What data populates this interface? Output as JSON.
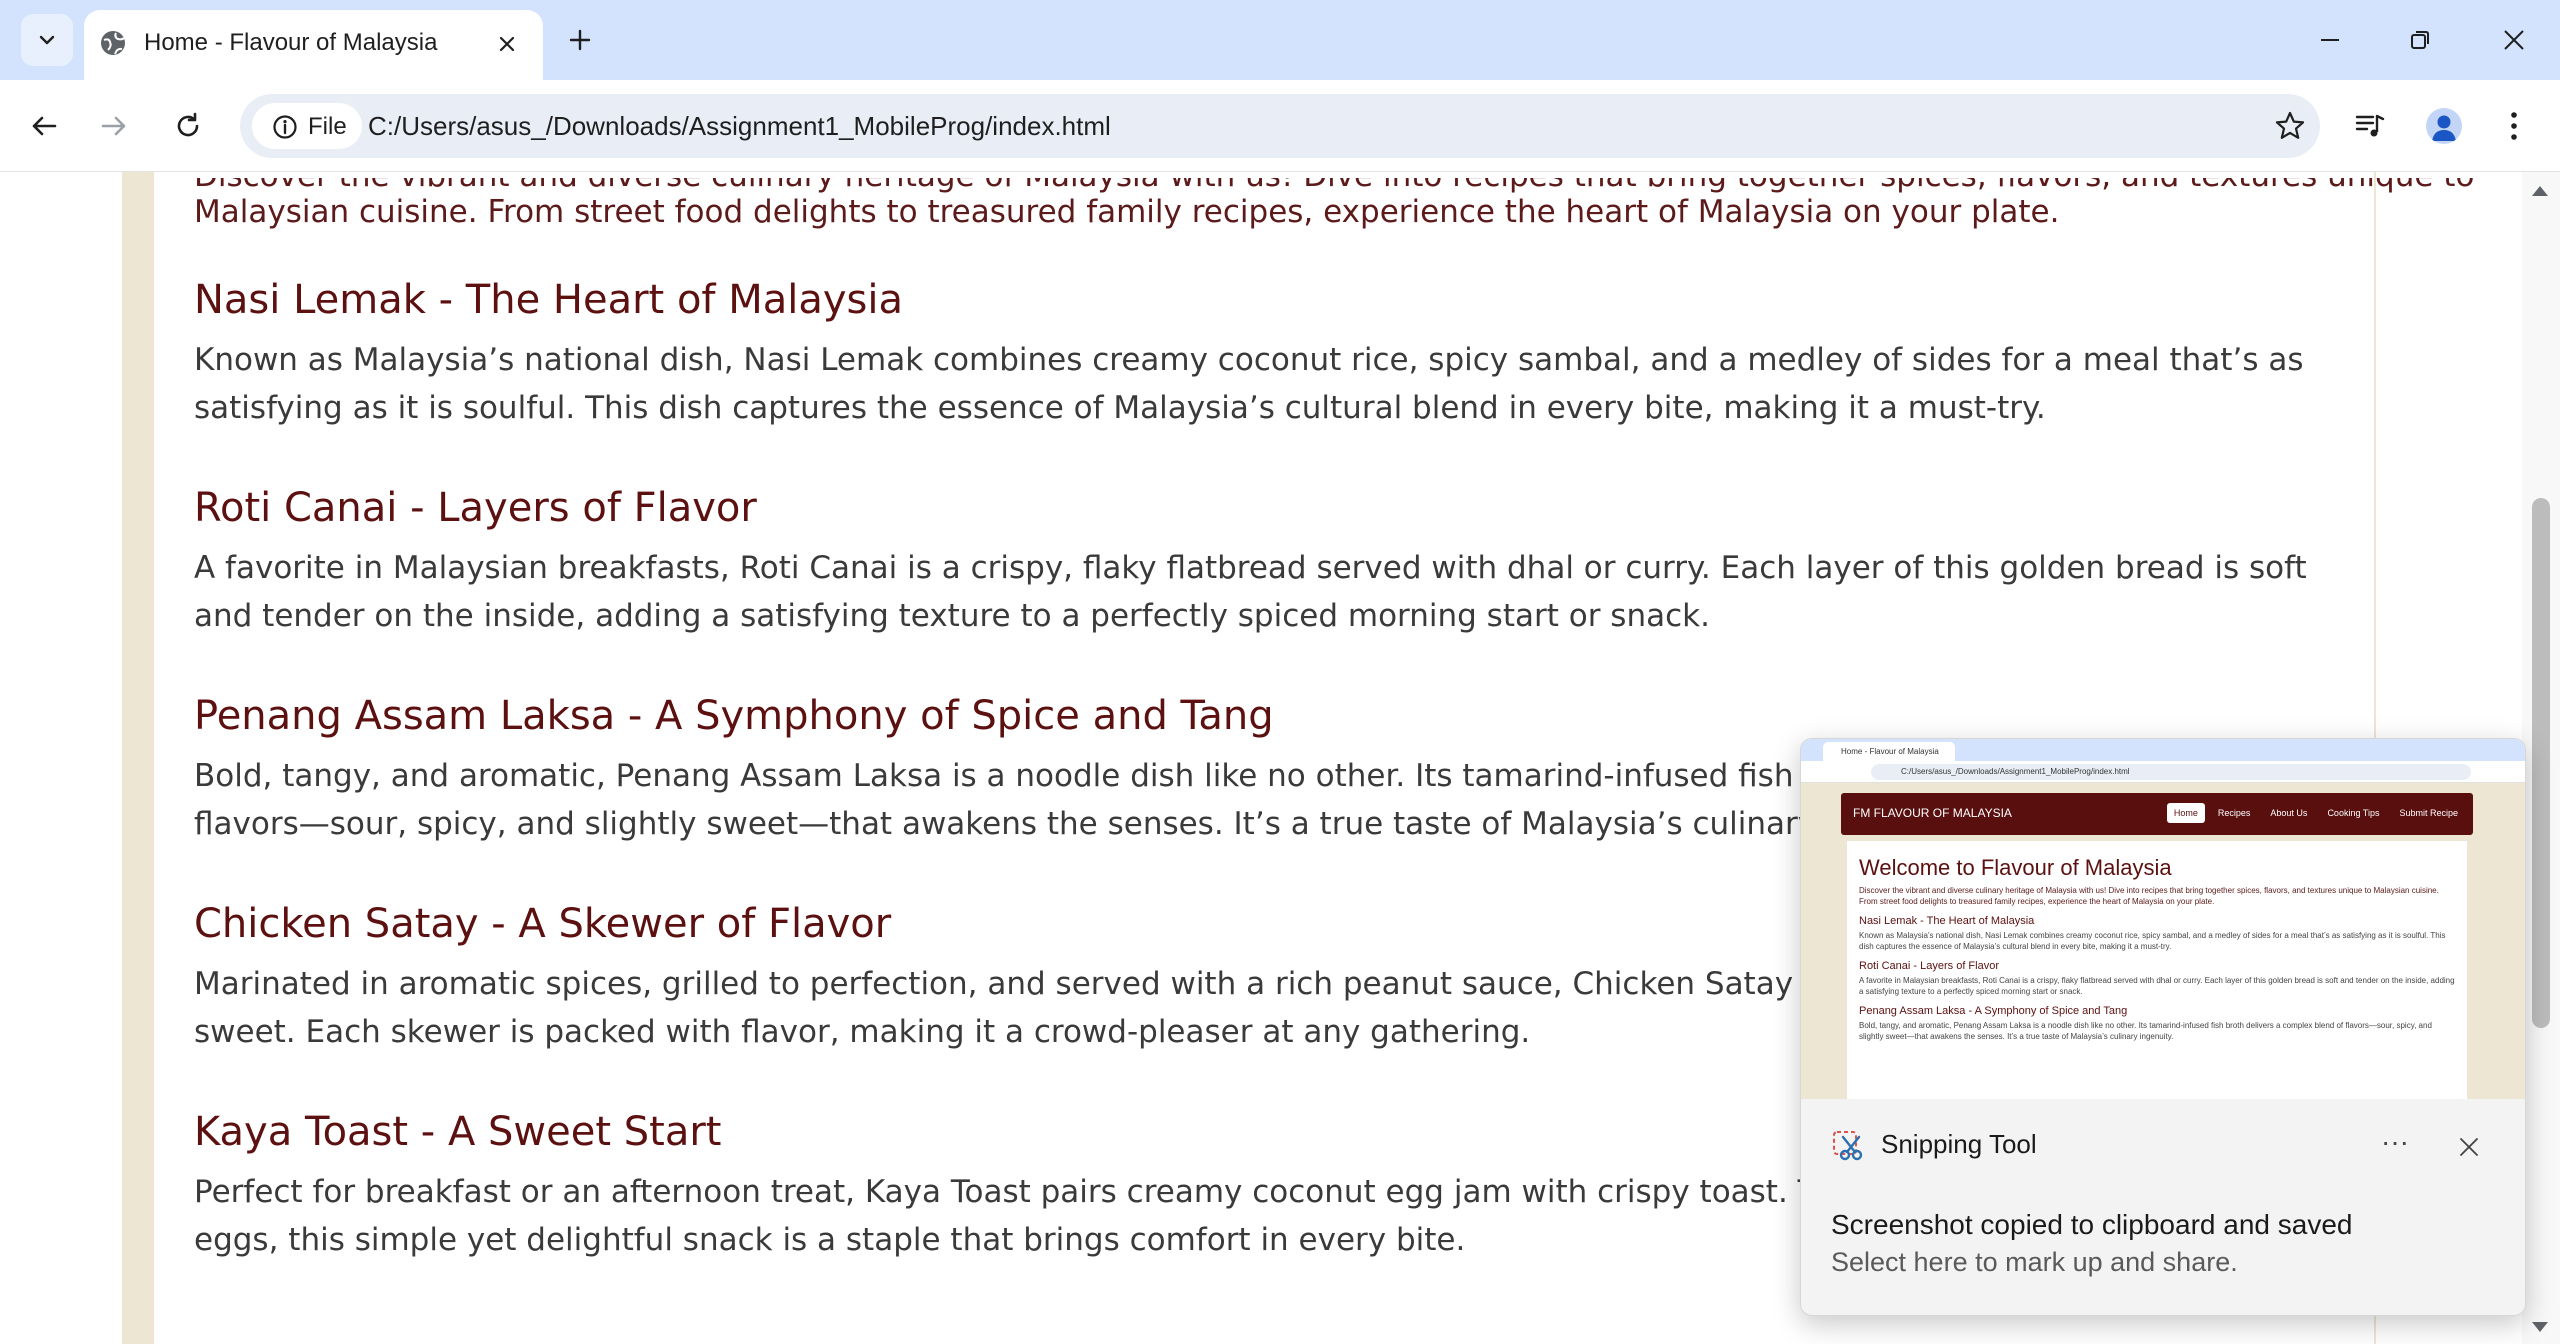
{
  "browser": {
    "tab_title": "Home - Flavour of Malaysia",
    "site_chip_label": "File",
    "url": "C:/Users/asus_/Downloads/Assignment1_MobileProg/index.html"
  },
  "page": {
    "intro_partial": "Discover the vibrant and diverse culinary heritage of Malaysia with us! Dive into recipes that bring together spices, flavors, and textures unique to",
    "intro_line2": "Malaysian cuisine. From street food delights to treasured family recipes, experience the heart of Malaysia on your plate.",
    "sections": [
      {
        "title": "Nasi Lemak - The Heart of Malaysia",
        "body": "Known as Malaysia’s national dish, Nasi Lemak combines creamy coconut rice, spicy sambal, and a medley of sides for a meal that’s as satisfying as it is soulful. This dish captures the essence of Malaysia’s cultural blend in every bite, making it a must-try."
      },
      {
        "title": "Roti Canai - Layers of Flavor",
        "body": "A favorite in Malaysian breakfasts, Roti Canai is a crispy, flaky flatbread served with dhal or curry. Each layer of this golden bread is soft and tender on the inside, adding a satisfying texture to a perfectly spiced morning start or snack."
      },
      {
        "title": "Penang Assam Laksa - A Symphony of Spice and Tang",
        "body": "Bold, tangy, and aromatic, Penang Assam Laksa is a noodle dish like no other. Its tamarind-infused fish broth delivers a complex blend of flavors—sour, spicy, and slightly sweet—that awakens the senses. It’s a true taste of Malaysia’s culinary ingenuity."
      },
      {
        "title": "Chicken Satay - A Skewer of Flavor",
        "body": "Marinated in aromatic spices, grilled to perfection, and served with a rich peanut sauce, Chicken Satay is the ideal blend of savory and sweet. Each skewer is packed with flavor, making it a crowd-pleaser at any gathering."
      },
      {
        "title": "Kaya Toast - A Sweet Start",
        "body": "Perfect for breakfast or an afternoon treat, Kaya Toast pairs creamy coconut egg jam with crispy toast. Traditionally served with soft-boiled eggs, this simple yet delightful snack is a staple that brings comfort in every bite."
      }
    ]
  },
  "notification": {
    "app_name": "Snipping Tool",
    "more_label": "···",
    "title": "Screenshot copied to clipboard and saved",
    "subtitle": "Select here to mark up and share.",
    "preview": {
      "tab_title": "Home - Flavour of Malaysia",
      "url": "C:/Users/asus_/Downloads/Assignment1_MobileProg/index.html",
      "brand": "FM  FLAVOUR OF MALAYSIA",
      "nav": [
        "Home",
        "Recipes",
        "About Us",
        "Cooking Tips",
        "Submit Recipe"
      ],
      "heading": "Welcome to Flavour of Malaysia",
      "intro": "Discover the vibrant and diverse culinary heritage of Malaysia with us! Dive into recipes that bring together spices, flavors, and textures unique to Malaysian cuisine. From street food delights to treasured family recipes, experience the heart of Malaysia on your plate.",
      "sections": [
        {
          "title": "Nasi Lemak - The Heart of Malaysia",
          "body": "Known as Malaysia’s national dish, Nasi Lemak combines creamy coconut rice, spicy sambal, and a medley of sides for a meal that’s as satisfying as it is soulful. This dish captures the essence of Malaysia’s cultural blend in every bite, making it a must-try."
        },
        {
          "title": "Roti Canai - Layers of Flavor",
          "body": "A favorite in Malaysian breakfasts, Roti Canai is a crispy, flaky flatbread served with dhal or curry. Each layer of this golden bread is soft and tender on the inside, adding a satisfying texture to a perfectly spiced morning start or snack."
        },
        {
          "title": "Penang Assam Laksa - A Symphony of Spice and Tang",
          "body": "Bold, tangy, and aromatic, Penang Assam Laksa is a noodle dish like no other. Its tamarind-infused fish broth delivers a complex blend of flavors—sour, spicy, and slightly sweet—that awakens the senses. It’s a true taste of Malaysia’s culinary ingenuity."
        }
      ]
    }
  },
  "icons": {
    "tab_search": "chevron-down-icon",
    "favicon": "globe-icon",
    "tab_close": "close-icon",
    "new_tab": "plus-icon",
    "back": "arrow-left-icon",
    "forward": "arrow-right-icon",
    "reload": "reload-icon",
    "site_info": "info-icon",
    "bookmark": "star-icon",
    "media": "media-control-icon",
    "profile": "profile-icon",
    "menu": "kebab-menu-icon",
    "minimize": "minimize-icon",
    "restore": "restore-icon",
    "close_window": "close-icon",
    "snipping_tool": "scissors-icon"
  },
  "colors": {
    "tabbar_bg": "#d3e3fd",
    "page_bg": "#ece6d3",
    "heading": "#5c1010",
    "intro_text": "#5c1a1a",
    "body_text": "#3a3a3a",
    "nav_bg": "#5a0f0f"
  }
}
